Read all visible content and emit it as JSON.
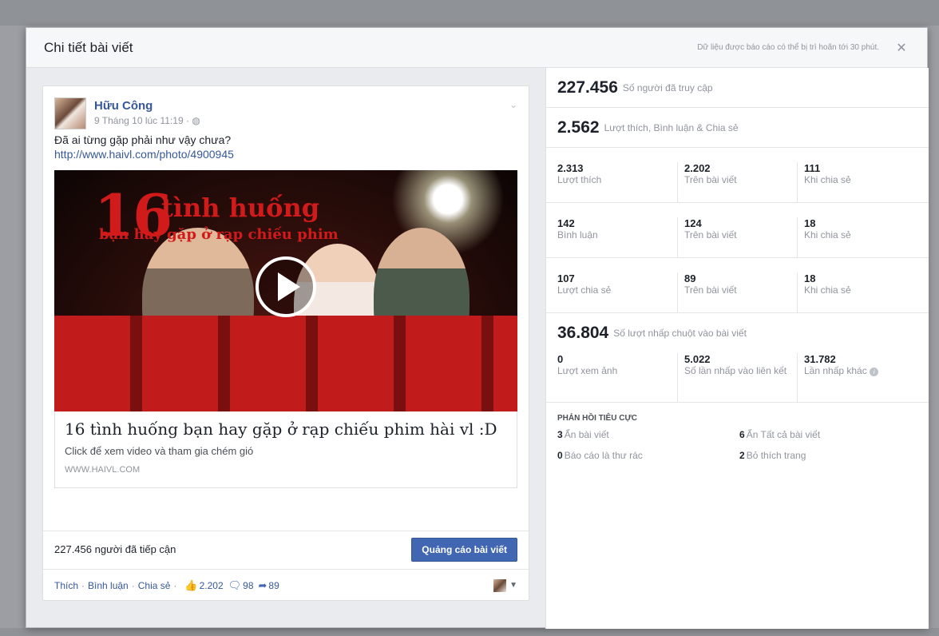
{
  "dialog": {
    "title": "Chi tiết bài viết",
    "note": "Dữ liệu được báo cáo có thể bị trì hoãn tới 30 phút.",
    "close_icon": "close-icon"
  },
  "post": {
    "author": "Hữu Công",
    "time": "9 Tháng 10 lúc 11:19 · ",
    "globe_icon": "globe-icon",
    "text": "Đã ai từng gặp phải như vậy chưa?",
    "link": "http://www.haivl.com/photo/4900945",
    "media": {
      "big_number": "16",
      "headline": "tình huống",
      "sub": "bạn hay gặp ở rạp chiếu phim"
    },
    "link_preview": {
      "title": "16 tình huống bạn hay gặp ở rạp chiếu phim hài vl :D",
      "description": "Click để xem video và tham gia chém gió",
      "domain": "WWW.HAIVL.COM"
    },
    "reach_text": "227.456 người đã tiếp cận",
    "boost_label": "Quảng cáo bài viết",
    "actions": {
      "like": "Thích",
      "comment": "Bình luận",
      "share": "Chia sẻ",
      "likes_count": "2.202",
      "comments_count": "98",
      "shares_count": "89"
    }
  },
  "stats": {
    "reach": {
      "value": "227.456",
      "label": "Số người đã truy cập"
    },
    "engagement": {
      "value": "2.562",
      "label": "Lượt thích, Bình luận & Chia sẻ"
    },
    "rows": [
      [
        {
          "value": "2.313",
          "label": "Lượt thích"
        },
        {
          "value": "2.202",
          "label": "Trên bài viết"
        },
        {
          "value": "111",
          "label": "Khi chia sẻ"
        }
      ],
      [
        {
          "value": "142",
          "label": "Bình luận"
        },
        {
          "value": "124",
          "label": "Trên bài viết"
        },
        {
          "value": "18",
          "label": "Khi chia sẻ"
        }
      ],
      [
        {
          "value": "107",
          "label": "Lượt chia sẻ"
        },
        {
          "value": "89",
          "label": "Trên bài viết"
        },
        {
          "value": "18",
          "label": "Khi chia sẻ"
        }
      ]
    ],
    "clicks": {
      "value": "36.804",
      "label": "Số lượt nhấp chuột vào bài viết"
    },
    "click_rows": [
      {
        "value": "0",
        "label": "Lượt xem ảnh"
      },
      {
        "value": "5.022",
        "label": "Số lần nhấp vào liên kết"
      },
      {
        "value": "31.782",
        "label": "Lần nhấp khác"
      }
    ],
    "negative": {
      "heading": "PHẢN HỒI TIÊU CỰC",
      "items": [
        {
          "value": "3",
          "label": "Ẩn bài viết"
        },
        {
          "value": "6",
          "label": "Ẩn Tất cả bài viết"
        },
        {
          "value": "0",
          "label": "Báo cáo là thư rác"
        },
        {
          "value": "2",
          "label": "Bỏ thích trang"
        }
      ]
    }
  }
}
